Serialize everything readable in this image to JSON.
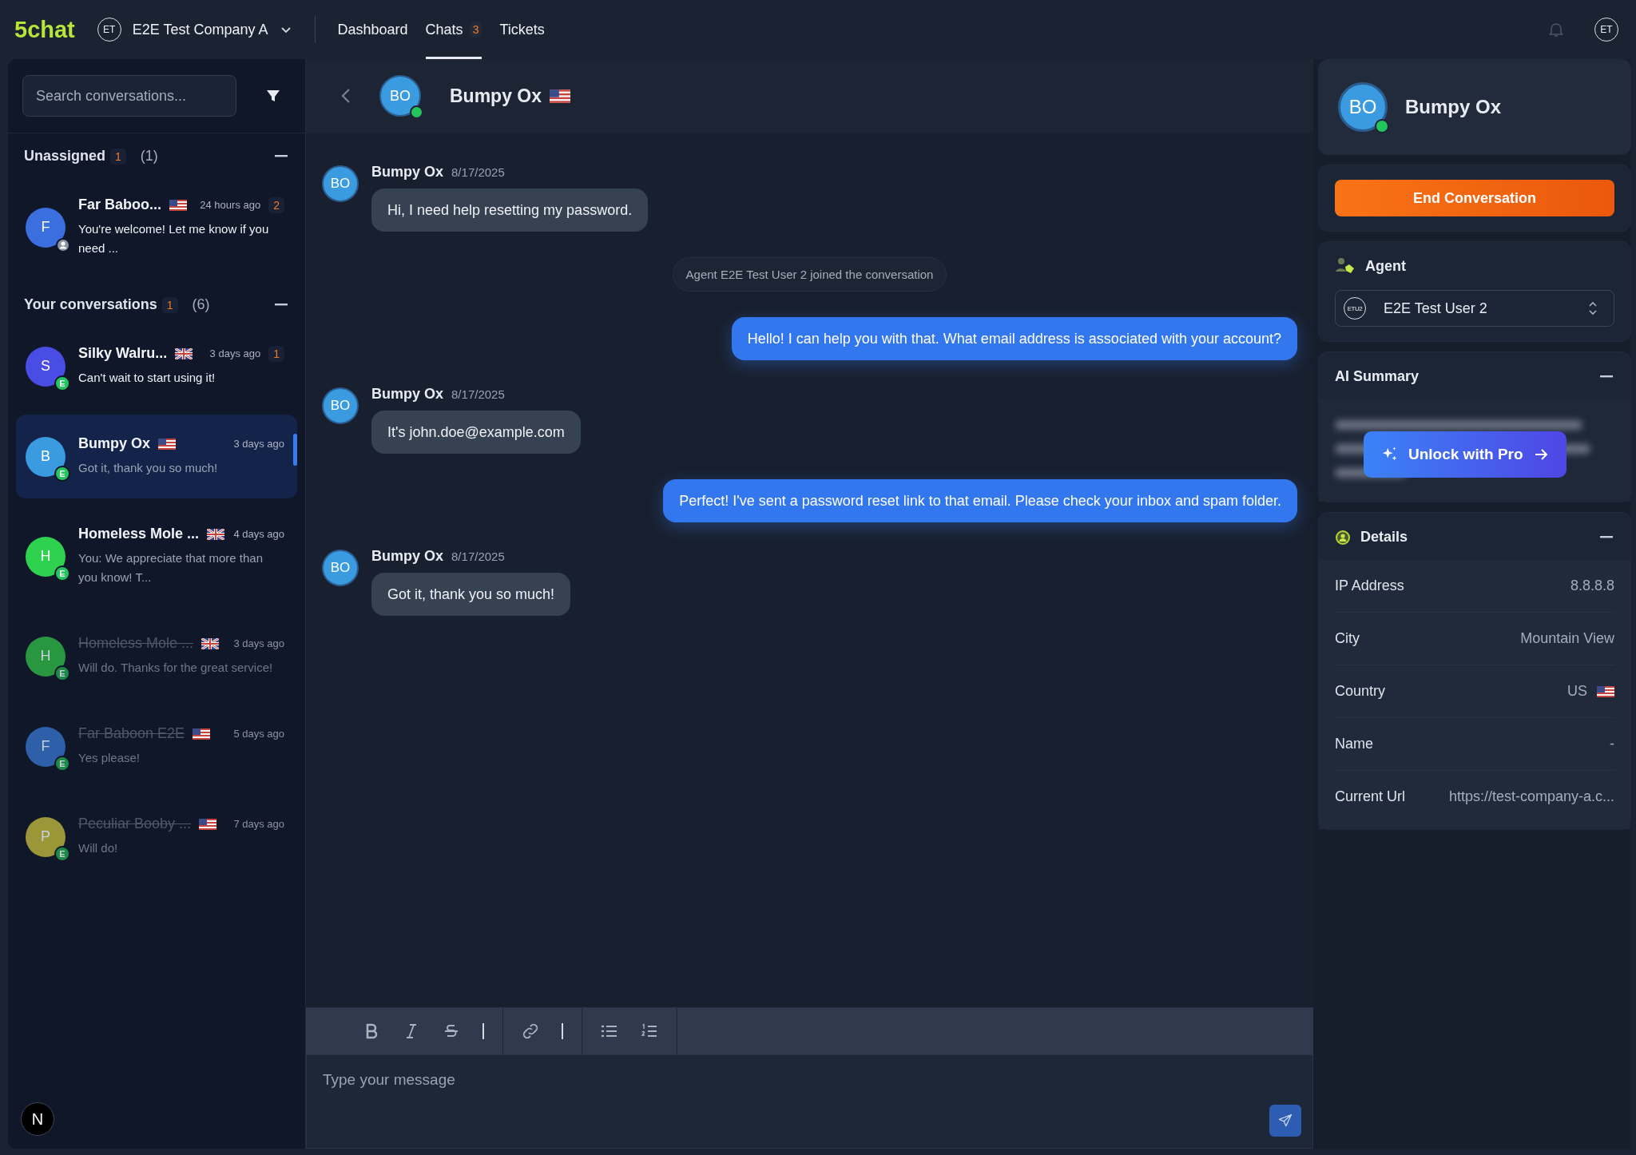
{
  "topbar": {
    "logo": "5chat",
    "company": {
      "initials": "ET",
      "name": "E2E Test Company A"
    },
    "nav": [
      {
        "label": "Dashboard",
        "selected": false
      },
      {
        "label": "Chats",
        "badge": "3",
        "selected": true
      },
      {
        "label": "Tickets",
        "selected": false
      }
    ],
    "user_initials": "ET"
  },
  "sidebar": {
    "search": {
      "placeholder": "Search conversations..."
    },
    "sections": [
      {
        "title": "Unassigned",
        "unread": "1",
        "count": "(1)",
        "conversations": [
          {
            "initial": "F",
            "color": "#3b6fe0",
            "badge": {
              "kind": "person"
            },
            "name": "Far Baboo...",
            "flag": {
              "kind": "us"
            },
            "time": "24 hours ago",
            "unread": "2",
            "preview": "You're welcome! Let me know if you need ...",
            "selected": false,
            "ended": false
          }
        ]
      },
      {
        "title": "Your conversations",
        "unread": "1",
        "count": "(6)",
        "conversations": [
          {
            "initial": "S",
            "color": "#4a4ce6",
            "badge": {
              "kind": "letter",
              "text": "E"
            },
            "name": "Silky Walru...",
            "flag": {
              "kind": "gb"
            },
            "time": "3 days ago",
            "unread": "1",
            "preview": "Can't wait to start using it!",
            "selected": false,
            "ended": false
          },
          {
            "initial": "B",
            "color": "#3a9be0",
            "badge": {
              "kind": "letter",
              "text": "E"
            },
            "name": "Bumpy Ox",
            "flag": {
              "kind": "us"
            },
            "time": "3 days ago",
            "preview": "Got it, thank you so much!",
            "selected": true,
            "ended": false
          },
          {
            "initial": "H",
            "color": "#2fd24f",
            "badge": {
              "kind": "letter",
              "text": "E"
            },
            "name": "Homeless Mole ...",
            "flag": {
              "kind": "gb"
            },
            "time": "4 days ago",
            "preview": "You: We appreciate that more than you know! T...",
            "selected": false,
            "ended": false
          },
          {
            "initial": "H",
            "color": "#29973f",
            "badge": {
              "kind": "letter",
              "text": "E"
            },
            "name": "Homeless Mole ...",
            "flag": {
              "kind": "gb"
            },
            "time": "3 days ago",
            "preview": "Will do. Thanks for the great service!",
            "selected": false,
            "ended": true
          },
          {
            "initial": "F",
            "color": "#2e5fa9",
            "badge": {
              "kind": "letter",
              "text": "E"
            },
            "name": "Far Baboon E2E",
            "flag": {
              "kind": "us"
            },
            "time": "5 days ago",
            "preview": "Yes please!",
            "selected": false,
            "ended": true
          },
          {
            "initial": "P",
            "color": "#9b9739",
            "badge": {
              "kind": "letter",
              "text": "E"
            },
            "name": "Peculiar Booby ...",
            "flag": {
              "kind": "us"
            },
            "time": "7 days ago",
            "preview": "Will do!",
            "selected": false,
            "ended": true
          }
        ]
      }
    ],
    "footer_initial": "N"
  },
  "chat": {
    "contact": {
      "initials": "BO",
      "name": "Bumpy Ox",
      "flag": {
        "kind": "us"
      },
      "online": true
    },
    "messages": [
      {
        "kind": "customer",
        "initials": "BO",
        "author": "Bumpy Ox",
        "date": "8/17/2025",
        "text": "Hi, I need help resetting my password."
      },
      {
        "kind": "system",
        "text": "Agent E2E Test User 2 joined the conversation"
      },
      {
        "kind": "agent",
        "text": "Hello! I can help you with that. What email address is associated with your account?"
      },
      {
        "kind": "customer",
        "initials": "BO",
        "author": "Bumpy Ox",
        "date": "8/17/2025",
        "text": "It's john.doe@example.com"
      },
      {
        "kind": "agent",
        "text": "Perfect! I've sent a password reset link to that email. Please check your inbox and spam folder."
      },
      {
        "kind": "customer",
        "initials": "BO",
        "author": "Bumpy Ox",
        "date": "8/17/2025",
        "text": "Got it, thank you so much!"
      }
    ],
    "toolbar": [
      {
        "tools": [
          {
            "kind": "bold"
          },
          {
            "kind": "italic"
          },
          {
            "kind": "strike"
          },
          {
            "kind": "divider"
          }
        ]
      },
      {
        "tools": [
          {
            "kind": "link"
          },
          {
            "kind": "divider"
          }
        ]
      },
      {
        "tools": [
          {
            "kind": "bullet"
          },
          {
            "kind": "numbered"
          }
        ]
      }
    ],
    "composer": {
      "placeholder": "Type your message"
    }
  },
  "details_panel": {
    "contact": {
      "initials": "BO",
      "name": "Bumpy Ox",
      "online": true
    },
    "end_button": "End Conversation",
    "agent": {
      "title": "Agent",
      "initials": "ETU2",
      "name": "E2E Test User 2"
    },
    "ai_summary": {
      "title": "AI Summary",
      "unlock_button": "Unlock with Pro"
    },
    "details": {
      "title": "Details",
      "rows": [
        {
          "label": "IP Address",
          "value": "8.8.8.8"
        },
        {
          "label": "City",
          "value": "Mountain View"
        },
        {
          "label": "Country",
          "value": "US",
          "flag": {
            "kind": "us"
          }
        },
        {
          "label": "Name",
          "value": "-"
        },
        {
          "label": "Current Url",
          "value": "https://test-company-a.c..."
        }
      ]
    }
  }
}
